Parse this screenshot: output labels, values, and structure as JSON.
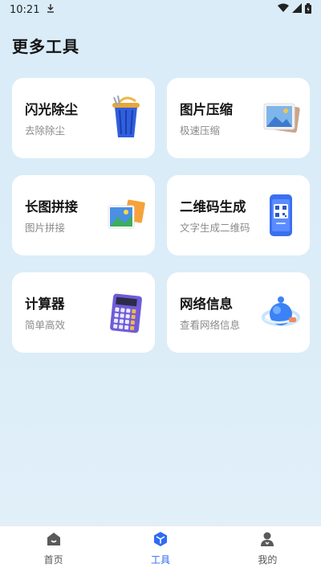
{
  "status_bar": {
    "time": "10:21"
  },
  "page": {
    "title": "更多工具"
  },
  "tools": [
    {
      "title": "闪光除尘",
      "subtitle": "去除除尘",
      "icon": "trash-bin-icon"
    },
    {
      "title": "图片压缩",
      "subtitle": "极速压缩",
      "icon": "image-compress-icon"
    },
    {
      "title": "长图拼接",
      "subtitle": "图片拼接",
      "icon": "image-stitch-icon"
    },
    {
      "title": "二维码生成",
      "subtitle": "文字生成二维码",
      "icon": "qr-phone-icon"
    },
    {
      "title": "计算器",
      "subtitle": "简单高效",
      "icon": "calculator-icon"
    },
    {
      "title": "网络信息",
      "subtitle": "查看网络信息",
      "icon": "network-globe-icon"
    }
  ],
  "bottom_nav": {
    "items": [
      {
        "label": "首页",
        "icon": "home-icon",
        "active": false
      },
      {
        "label": "工具",
        "icon": "tools-cube-icon",
        "active": true
      },
      {
        "label": "我的",
        "icon": "profile-icon",
        "active": false
      }
    ]
  },
  "colors": {
    "background": "#dcedf8",
    "card": "#ffffff",
    "accent": "#2f6bf2",
    "subtitle": "#8a8a8a"
  }
}
